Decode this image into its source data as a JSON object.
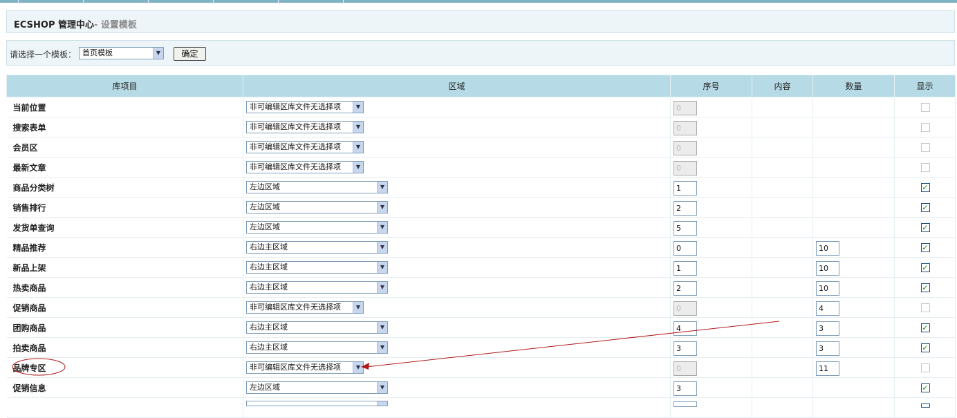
{
  "header": {
    "title": "ECSHOP 管理中心",
    "subtitle": "- 设置模板"
  },
  "filter": {
    "label": "请选择一个模板：",
    "selected_template": "首页模板",
    "confirm_label": "确定"
  },
  "table": {
    "columns": [
      "库项目",
      "区域",
      "序号",
      "内容",
      "数量",
      "显示"
    ],
    "rows": [
      {
        "name": "当前位置",
        "region": "非可编辑区库文件无选择项",
        "order": "0",
        "order_disabled": true,
        "qty": "",
        "show": false,
        "show_disabled": true
      },
      {
        "name": "搜索表单",
        "region": "非可编辑区库文件无选择项",
        "order": "0",
        "order_disabled": true,
        "qty": "",
        "show": false,
        "show_disabled": true
      },
      {
        "name": "会员区",
        "region": "非可编辑区库文件无选择项",
        "order": "0",
        "order_disabled": true,
        "qty": "",
        "show": false,
        "show_disabled": true
      },
      {
        "name": "最新文章",
        "region": "非可编辑区库文件无选择项",
        "order": "0",
        "order_disabled": true,
        "qty": "",
        "show": false,
        "show_disabled": true
      },
      {
        "name": "商品分类树",
        "region": "左边区域",
        "order": "1",
        "order_disabled": false,
        "qty": "",
        "show": true,
        "show_disabled": false
      },
      {
        "name": "销售排行",
        "region": "左边区域",
        "order": "2",
        "order_disabled": false,
        "qty": "",
        "show": true,
        "show_disabled": false
      },
      {
        "name": "发货单查询",
        "region": "左边区域",
        "order": "5",
        "order_disabled": false,
        "qty": "",
        "show": true,
        "show_disabled": false
      },
      {
        "name": "精品推荐",
        "region": "右边主区域",
        "order": "0",
        "order_disabled": false,
        "qty": "10",
        "show": true,
        "show_disabled": false
      },
      {
        "name": "新品上架",
        "region": "右边主区域",
        "order": "1",
        "order_disabled": false,
        "qty": "10",
        "show": true,
        "show_disabled": false
      },
      {
        "name": "热卖商品",
        "region": "右边主区域",
        "order": "2",
        "order_disabled": false,
        "qty": "10",
        "show": true,
        "show_disabled": false
      },
      {
        "name": "促销商品",
        "region": "非可编辑区库文件无选择项",
        "order": "0",
        "order_disabled": true,
        "qty": "4",
        "show": false,
        "show_disabled": true
      },
      {
        "name": "团购商品",
        "region": "右边主区域",
        "order": "4",
        "order_disabled": false,
        "qty": "3",
        "show": true,
        "show_disabled": false
      },
      {
        "name": "拍卖商品",
        "region": "右边主区域",
        "order": "3",
        "order_disabled": false,
        "qty": "3",
        "show": true,
        "show_disabled": false
      },
      {
        "name": "品牌专区",
        "region": "非可编辑区库文件无选择项",
        "order": "0",
        "order_disabled": true,
        "qty": "11",
        "show": false,
        "show_disabled": true
      },
      {
        "name": "促销信息",
        "region": "左边区域",
        "order": "3",
        "order_disabled": false,
        "qty": "",
        "show": true,
        "show_disabled": false
      },
      {
        "name": "",
        "region": "",
        "order": "",
        "order_disabled": false,
        "qty": "",
        "show": true,
        "show_disabled": false
      }
    ]
  },
  "colors": {
    "header_bg": "#b7dbe6",
    "panel_bg": "#eef5f8",
    "check_color": "#1a8a1a",
    "annotation_color": "#b01818"
  }
}
